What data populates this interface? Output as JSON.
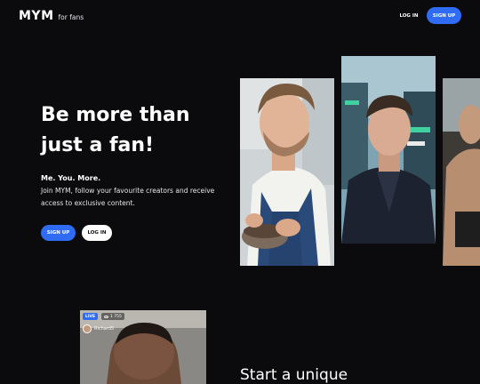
{
  "header": {
    "logo_text": "MYM",
    "logo_subtext": "for fans",
    "login_label": "LOG IN",
    "signup_label": "SIGN UP"
  },
  "hero": {
    "title": "Be more than just a fan!",
    "tagline": "Me. You. More.",
    "description": "Join MYM, follow your favourite creators and receive access to exclusive content.",
    "signup_label": "SIGN UP",
    "login_label": "LOG IN"
  },
  "live_preview": {
    "badge": "LIVE",
    "viewers": "1 755",
    "username": "Richard5"
  },
  "section": {
    "title": "Start a unique"
  },
  "colors": {
    "background": "#0b0b0e",
    "accent": "#2f6bf3",
    "text": "#ffffff"
  }
}
